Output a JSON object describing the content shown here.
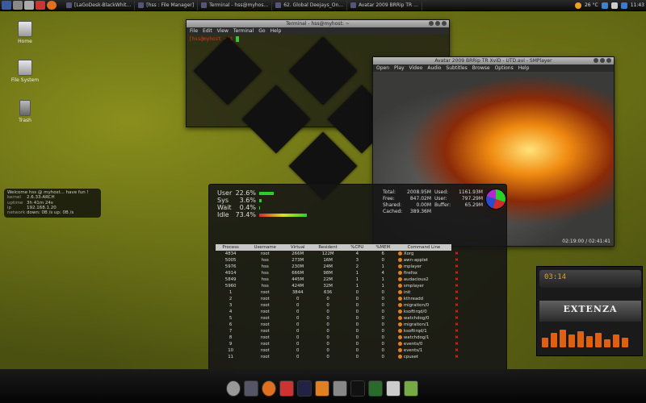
{
  "top_panel": {
    "tasks": [
      {
        "title": "[LaGoDesk-BlackWhit..."
      },
      {
        "title": "[hss : File Manager]"
      },
      {
        "title": "Terminal - hss@myhos..."
      },
      {
        "title": "62. Global Deejays_On..."
      },
      {
        "title": "Avatar 2009 BRRip TR ..."
      }
    ],
    "temperature": "26 °C",
    "clock": "11:43"
  },
  "desktop_icons": [
    {
      "label": "Home"
    },
    {
      "label": "File System"
    },
    {
      "label": "Trash"
    }
  ],
  "terminal": {
    "title": "Terminal - hss@myhost: ~",
    "menu": [
      "File",
      "Edit",
      "View",
      "Terminal",
      "Go",
      "Help"
    ],
    "prompt": "[hss@myhost ~]$"
  },
  "video_player": {
    "title": "Avatar 2009 BRRip TR XviD - UTD.avi - SMPlayer",
    "menu": [
      "Open",
      "Play",
      "Video",
      "Audio",
      "Subtitles",
      "Browse",
      "Options",
      "Help"
    ],
    "time": "02:19:00 / 02:41:41"
  },
  "conky": {
    "welcome": "Welcome hss @ myhost... have fun !",
    "rows": [
      {
        "key": "kernel",
        "value": "2.6.33-ARCH"
      },
      {
        "key": "uptime",
        "value": "3h 41m 24s"
      },
      {
        "key": "ip",
        "value": "192.168.1.20"
      },
      {
        "key": "network",
        "value": "down: 0B /s   up: 0B /s"
      }
    ]
  },
  "sysmon": {
    "cpu": [
      {
        "label": "User",
        "value": "22.6%",
        "fraction": 0.226
      },
      {
        "label": "Sys",
        "value": "3.6%",
        "fraction": 0.036
      },
      {
        "label": "Wait",
        "value": "0.4%",
        "fraction": 0.004
      },
      {
        "label": "Idle",
        "value": "73.4%",
        "fraction": 0.734
      }
    ],
    "memory": [
      {
        "k1": "Total:",
        "v1": "2008.95M",
        "k2": "Used:",
        "v2": "1161.93M"
      },
      {
        "k1": "Free:",
        "v1": "847.02M",
        "k2": "User:",
        "v2": "797.29M"
      },
      {
        "k1": "Shared:",
        "v1": "0.00M",
        "k2": "Buffer:",
        "v2": "65.29M"
      },
      {
        "k1": "Cached:",
        "v1": "389.36M",
        "k2": "",
        "v2": ""
      }
    ],
    "columns": [
      "Process",
      "Username",
      "Virtual",
      "Resident",
      "%CPU",
      "%MEM",
      "Command Line"
    ],
    "processes": [
      [
        "4834",
        "root",
        "266M",
        "122M",
        "4",
        "6",
        "Xorg"
      ],
      [
        "5005",
        "hss",
        "273M",
        "16M",
        "3",
        "0",
        "awn-applet"
      ],
      [
        "5976",
        "hss",
        "230M",
        "24M",
        "2",
        "1",
        "mplayer"
      ],
      [
        "4914",
        "hss",
        "666M",
        "98M",
        "1",
        "4",
        "firefox"
      ],
      [
        "5849",
        "hss",
        "445M",
        "22M",
        "1",
        "1",
        "audacious2"
      ],
      [
        "5960",
        "hss",
        "424M",
        "32M",
        "1",
        "1",
        "smplayer"
      ],
      [
        "1",
        "root",
        "3844",
        "636",
        "0",
        "0",
        "init"
      ],
      [
        "2",
        "root",
        "0",
        "0",
        "0",
        "0",
        "kthreadd"
      ],
      [
        "3",
        "root",
        "0",
        "0",
        "0",
        "0",
        "migration/0"
      ],
      [
        "4",
        "root",
        "0",
        "0",
        "0",
        "0",
        "ksoftirqd/0"
      ],
      [
        "5",
        "root",
        "0",
        "0",
        "0",
        "0",
        "watchdog/0"
      ],
      [
        "6",
        "root",
        "0",
        "0",
        "0",
        "0",
        "migration/1"
      ],
      [
        "7",
        "root",
        "0",
        "0",
        "0",
        "0",
        "ksoftirqd/1"
      ],
      [
        "8",
        "root",
        "0",
        "0",
        "0",
        "0",
        "watchdog/1"
      ],
      [
        "9",
        "root",
        "0",
        "0",
        "0",
        "0",
        "events/0"
      ],
      [
        "10",
        "root",
        "0",
        "0",
        "0",
        "0",
        "events/1"
      ],
      [
        "11",
        "root",
        "0",
        "0",
        "0",
        "0",
        "cpuset"
      ]
    ]
  },
  "audacious": {
    "time": "03:14",
    "logo": "EXTENZA"
  }
}
